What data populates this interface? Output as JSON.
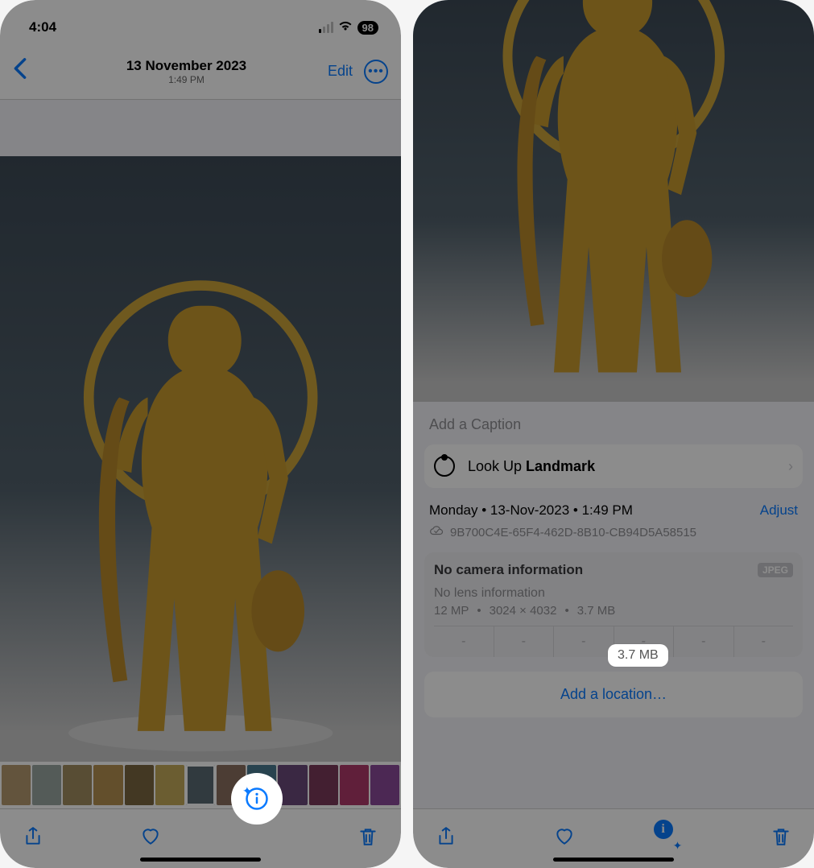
{
  "left": {
    "status": {
      "time": "4:04",
      "battery": "98"
    },
    "nav": {
      "date": "13 November 2023",
      "time": "1:49 PM",
      "edit": "Edit"
    }
  },
  "right": {
    "caption_placeholder": "Add a Caption",
    "lookup": {
      "prefix": "Look Up ",
      "subject": "Landmark"
    },
    "meta": {
      "day": "Monday",
      "date": "13-Nov-2023",
      "time": "1:49 PM",
      "adjust": "Adjust",
      "uuid": "9B700C4E-65F4-462D-8B10-CB94D5A58515"
    },
    "camera": {
      "no_camera": "No camera information",
      "format": "JPEG",
      "no_lens": "No lens information",
      "mp": "12 MP",
      "dims": "3024 × 4032",
      "size": "3.7 MB"
    },
    "add_location": "Add a location…"
  }
}
